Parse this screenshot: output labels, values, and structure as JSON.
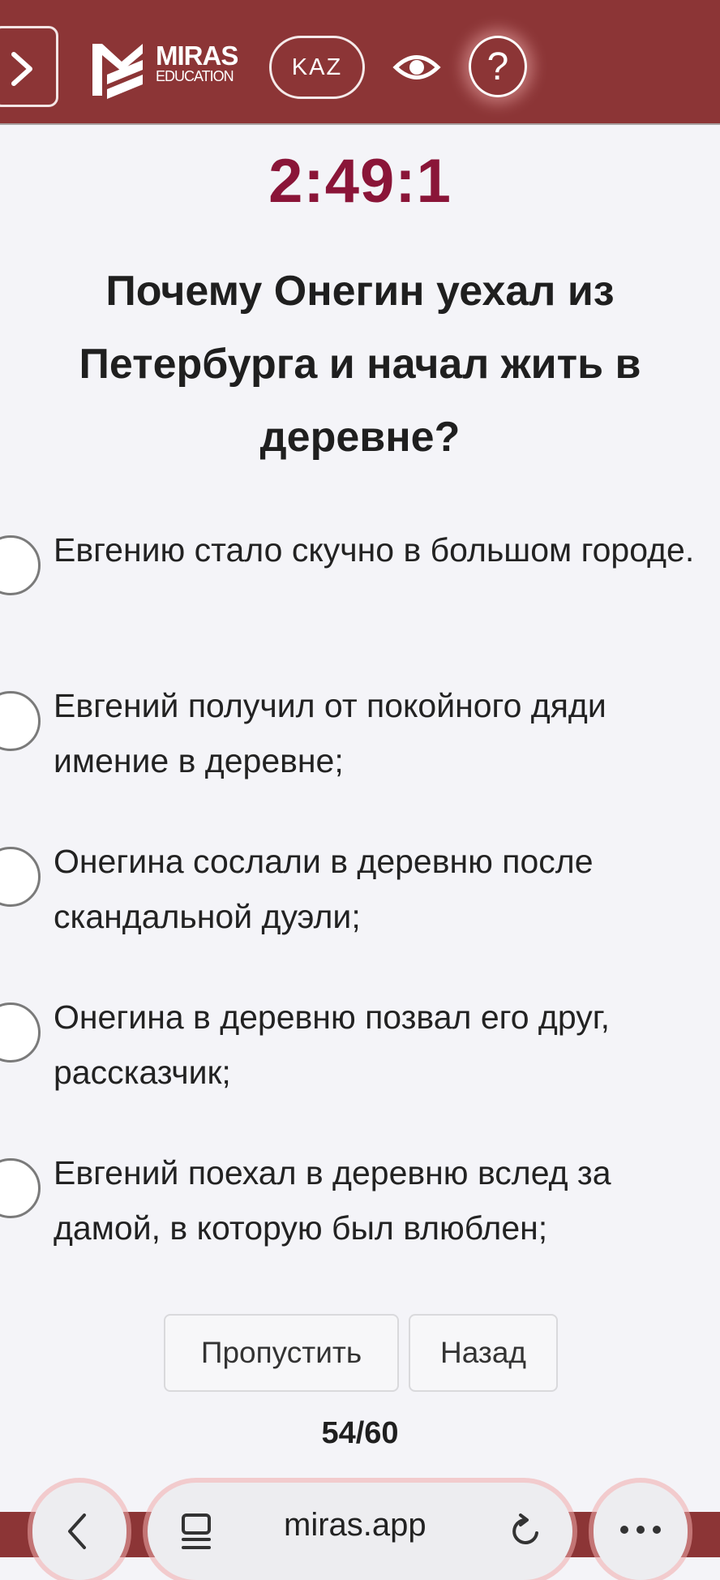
{
  "header": {
    "logo": {
      "line1": "MIRAS",
      "line2": "EDUCATION"
    },
    "language_label": "KAZ",
    "help_symbol": "?",
    "background_color": "#8c3536",
    "icons": [
      "chevron-right-icon",
      "eye-icon",
      "question-icon"
    ]
  },
  "timer": {
    "value": "2:49:1",
    "color": "#8a1538"
  },
  "question": {
    "text": "Почему Онегин уехал из Петербурга и начал жить в деревне?"
  },
  "options": [
    {
      "text": "Евгению стало скучно в большом городе.",
      "selected": false
    },
    {
      "text": "Евгений получил от покойного дяди имение в деревне;",
      "selected": false
    },
    {
      "text": "Онегина сослали в деревню после скандальной дуэли;",
      "selected": false
    },
    {
      "text": "Онегина в деревню позвал его друг, рассказчик;",
      "selected": false
    },
    {
      "text": "Евгений поехал в деревню вслед за дамой, в которую был влюблен;",
      "selected": false
    }
  ],
  "actions": {
    "skip_label": "Пропустить",
    "back_label": "Назад"
  },
  "progress": {
    "label": "54/60",
    "current": 54,
    "total": 60
  },
  "browser": {
    "url": "miras.app",
    "icons": [
      "chevron-left-icon",
      "reader-icon",
      "reload-icon",
      "more-icon"
    ]
  }
}
